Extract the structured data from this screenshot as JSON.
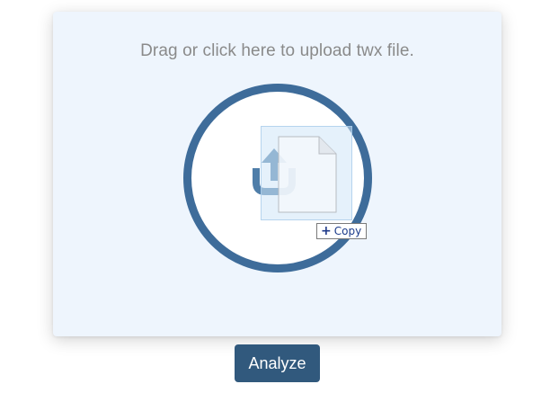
{
  "dropzone": {
    "title": "Drag or click here to upload twx file.",
    "icon": "upload-icon"
  },
  "drag_ghost": {
    "icon": "file-icon",
    "tooltip_label": "Copy",
    "tooltip_icon": "plus-icon"
  },
  "actions": {
    "analyze_label": "Analyze"
  },
  "colors": {
    "dropzone_bg": "#eef5fd",
    "circle_border": "#3e6c9a",
    "button_bg": "#31597d",
    "title_text": "#8a8a8a"
  }
}
